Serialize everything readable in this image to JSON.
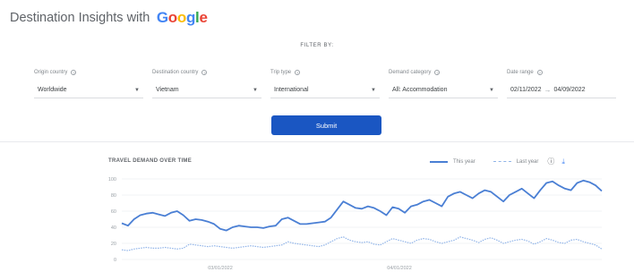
{
  "header": {
    "title": "Destination Insights with",
    "logo_letters": [
      "G",
      "o",
      "o",
      "g",
      "l",
      "e"
    ]
  },
  "filter": {
    "title": "FILTER BY:",
    "fields": [
      {
        "label": "Origin country",
        "value": "Worldwide"
      },
      {
        "label": "Destination country",
        "value": "Vietnam"
      },
      {
        "label": "Trip type",
        "value": "International"
      },
      {
        "label": "Demand category",
        "value": "All: Accommodation"
      },
      {
        "label": "Date range",
        "start": "02/11/2022",
        "end": "04/09/2022"
      }
    ],
    "submit_label": "Submit"
  },
  "chart": {
    "title": "TRAVEL DEMAND OVER TIME",
    "legend": {
      "this_year": "This year",
      "last_year": "Last year"
    }
  },
  "chart_data": {
    "type": "line",
    "title": "TRAVEL DEMAND OVER TIME",
    "ylim": [
      0,
      100
    ],
    "yticks": [
      0,
      20,
      40,
      60,
      80,
      100
    ],
    "xtick_labels": [
      "03/01/2022",
      "04/01/2022"
    ],
    "grid": true,
    "legend_placement": "top-right",
    "series": [
      {
        "name": "This year",
        "color": "#4a7fd4",
        "style": "solid",
        "values": [
          45,
          42,
          50,
          55,
          57,
          58,
          56,
          54,
          58,
          60,
          55,
          48,
          50,
          49,
          47,
          44,
          38,
          36,
          40,
          42,
          41,
          40,
          40,
          39,
          41,
          42,
          50,
          52,
          48,
          44,
          44,
          45,
          46,
          47,
          52,
          62,
          72,
          68,
          64,
          63,
          66,
          64,
          60,
          55,
          65,
          63,
          58,
          66,
          68,
          72,
          74,
          70,
          66,
          78,
          82,
          84,
          80,
          76,
          82,
          86,
          84,
          78,
          72,
          80,
          84,
          88,
          82,
          76,
          86,
          95,
          97,
          92,
          88,
          86,
          95,
          98,
          96,
          92,
          85
        ]
      },
      {
        "name": "Last year",
        "color": "#8fb3e8",
        "style": "dashed",
        "values": [
          12,
          11,
          13,
          14,
          15,
          14,
          14,
          15,
          14,
          13,
          14,
          19,
          18,
          17,
          16,
          17,
          16,
          15,
          14,
          15,
          16,
          17,
          16,
          15,
          16,
          17,
          18,
          22,
          20,
          19,
          18,
          17,
          16,
          18,
          22,
          26,
          28,
          24,
          22,
          21,
          22,
          19,
          18,
          22,
          26,
          24,
          22,
          20,
          24,
          26,
          25,
          22,
          20,
          22,
          24,
          28,
          26,
          24,
          21,
          25,
          27,
          24,
          20,
          22,
          24,
          25,
          23,
          19,
          22,
          26,
          24,
          21,
          20,
          24,
          25,
          22,
          20,
          18,
          13
        ]
      }
    ]
  }
}
